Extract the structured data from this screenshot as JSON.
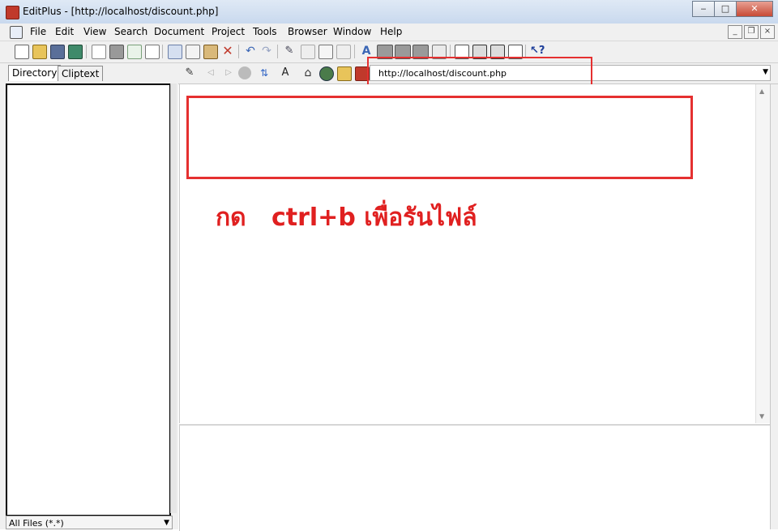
{
  "window": {
    "title": "EditPlus - [http://localhost/discount.php]",
    "controls": {
      "minimize": "‒",
      "maximize": "□",
      "close": "✕"
    }
  },
  "menu": {
    "items": [
      "File",
      "Edit",
      "View",
      "Search",
      "Document",
      "Project",
      "Tools",
      "Browser",
      "Window",
      "Help"
    ],
    "mdi": {
      "minimize": "_",
      "restore": "❐",
      "close": "×"
    }
  },
  "toolbar": {
    "icons": [
      "new-file-icon",
      "open-folder-icon",
      "save-icon",
      "save-all-icon",
      "print-preview-icon",
      "print-icon",
      "spellcheck-icon",
      "properties-icon",
      "cut-icon",
      "copy-icon",
      "paste-icon",
      "delete-icon",
      "undo-icon",
      "redo-icon",
      "highlight-icon",
      "replace-icon",
      "clipboard-icon",
      "indent-icon",
      "font-icon",
      "word-wrap-icon",
      "line-number-icon",
      "ruler-icon",
      "column-icon",
      "toggle-panel-icon",
      "toggle-output-icon",
      "toggle-browser-icon",
      "toggle-fullscreen-icon",
      "help-icon"
    ]
  },
  "left_panel": {
    "tabs": [
      "Directory",
      "Cliptext"
    ],
    "active_tab": "Directory",
    "file_filter": "All Files (*.*)"
  },
  "browser_bar": {
    "url": "http://localhost/discount.php"
  },
  "annotation": {
    "text": "กด   ctrl+b เพื่อรันไฟล์",
    "color": "#e02020"
  }
}
